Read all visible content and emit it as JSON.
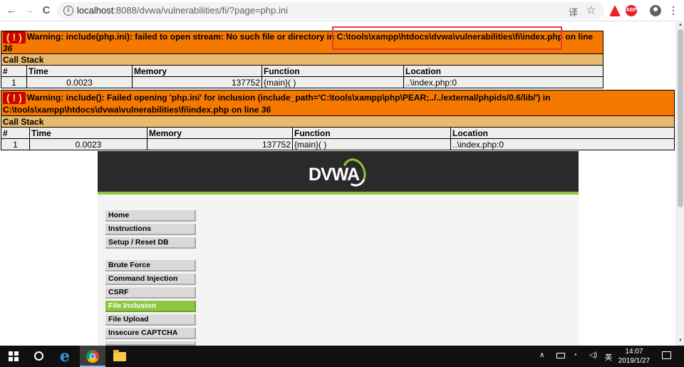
{
  "browser": {
    "back_icon": "←",
    "forward_icon": "→",
    "reload_icon": "C",
    "url_host": "localhost",
    "url_rest": ":8088/dvwa/vulnerabilities/fi/?page=php.ini",
    "translate_icon": "译",
    "star_icon": "☆",
    "ext_abp_label": "ABP",
    "menu_icon": "⋮"
  },
  "error1": {
    "bang": "( ! )",
    "prefix": "Warning: include(php.ini): failed to open stream: No such file or directory in ",
    "path": "C:\\tools\\xampp\\htdocs\\dvwa\\vulnerabilities\\fi\\index.php",
    "suffix": " on line ",
    "line": "36",
    "callstack_label": "Call Stack",
    "headers": [
      "#",
      "Time",
      "Memory",
      "Function",
      "Location"
    ],
    "row": [
      "1",
      "0.0023",
      "137752",
      "{main}( )",
      "..\\index.php:0"
    ]
  },
  "error2": {
    "bang": "( ! )",
    "line1": "Warning: include(): Failed opening 'php.ini' for inclusion (include_path='C:\\tools\\xampp\\php\\PEAR;../../external/phpids/0.6/lib/') in",
    "line2_prefix": "C:\\tools\\xampp\\htdocs\\dvwa\\vulnerabilities\\fi\\index.php on line ",
    "line": "36",
    "callstack_label": "Call Stack",
    "headers": [
      "#",
      "Time",
      "Memory",
      "Function",
      "Location"
    ],
    "row": [
      "1",
      "0.0023",
      "137752",
      "{main}( )",
      "..\\index.php:0"
    ]
  },
  "dvwa": {
    "logo_text": "DVWA",
    "menu_top": [
      "Home",
      "Instructions",
      "Setup / Reset DB"
    ],
    "menu_vulns": [
      "Brute Force",
      "Command Injection",
      "CSRF",
      "File Inclusion",
      "File Upload",
      "Insecure CAPTCHA"
    ],
    "selected": "File Inclusion"
  },
  "taskbar": {
    "tray_chevron": "∧",
    "ime": "英",
    "time": "14:07",
    "date": "2019/1/27"
  },
  "colors": {
    "error_bg": "#f57900",
    "callstack_bg": "#e9b96e",
    "dvwa_green": "#8dc63f",
    "highlight_red": "#e53935"
  }
}
